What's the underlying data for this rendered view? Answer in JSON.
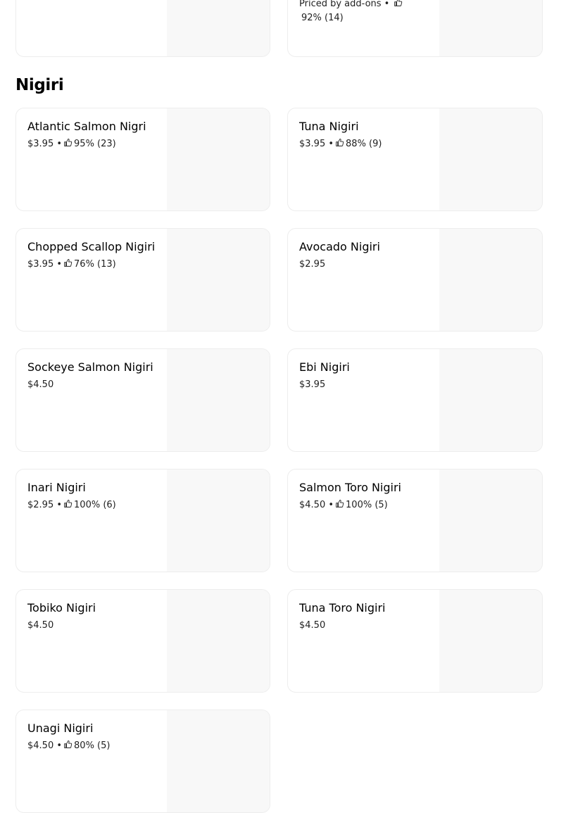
{
  "previous_section": {
    "card_right": {
      "meta_line1": "Priced by add-ons •",
      "meta_line2": "92% (14)"
    }
  },
  "section": {
    "title": "Nigiri",
    "items": [
      {
        "name": "Atlantic Salmon Nigri",
        "price": "$3.95",
        "rating": "95% (23)"
      },
      {
        "name": "Tuna Nigiri",
        "price": "$3.95",
        "rating": "88% (9)"
      },
      {
        "name": "Chopped Scallop Nigiri",
        "price": "$3.95",
        "rating": "76% (13)"
      },
      {
        "name": "Avocado Nigiri",
        "price": "$2.95",
        "rating": ""
      },
      {
        "name": "Sockeye Salmon Nigiri",
        "price": "$4.50",
        "rating": ""
      },
      {
        "name": "Ebi Nigiri",
        "price": "$3.95",
        "rating": ""
      },
      {
        "name": "Inari Nigiri",
        "price": "$2.95",
        "rating": "100% (6)"
      },
      {
        "name": "Salmon Toro Nigiri",
        "price": "$4.50",
        "rating": "100% (5)"
      },
      {
        "name": "Tobiko Nigiri",
        "price": "$4.50",
        "rating": ""
      },
      {
        "name": "Tuna Toro Nigiri",
        "price": "$4.50",
        "rating": ""
      },
      {
        "name": "Unagi Nigiri",
        "price": "$4.50",
        "rating": "80% (5)"
      }
    ]
  },
  "icons": {
    "rating": "thumbs-up-icon"
  }
}
